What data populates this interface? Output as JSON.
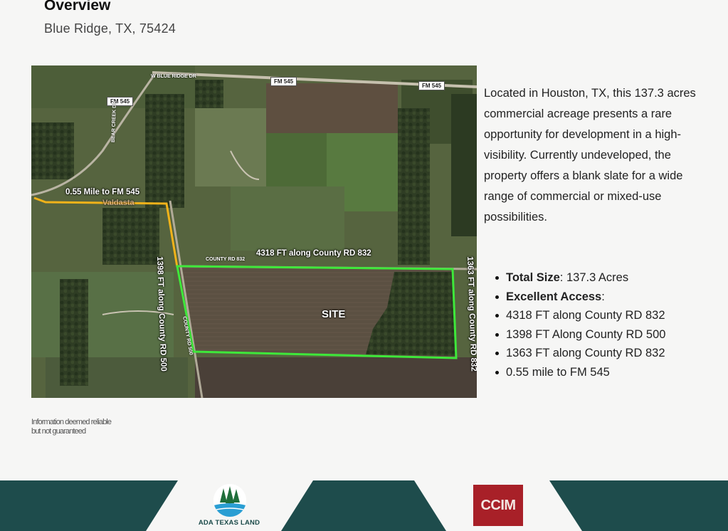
{
  "header": {
    "title": "Overview",
    "subtitle": "Blue Ridge, TX, 75424"
  },
  "map": {
    "labels": {
      "fm545_distance": "0.55 Mile to FM 545",
      "rd832_north": "4318 FT along County RD 832",
      "rd500": "1398 FT along County RD 500",
      "rd832_east": "1363 FT along County RD 832",
      "site": "SITE",
      "town": "Valdasta"
    },
    "roads": {
      "blue_ridge_dr": "W BLUE RIDGE DR",
      "fm545_a": "FM 545",
      "fm545_b": "FM 545",
      "fm545_c": "FM 545",
      "bear_creek_dr": "BEAR CREEK DR",
      "county_rd_832": "COUNTY RD 832",
      "county_rd_500": "COUNTY RD 500"
    },
    "colors": {
      "site_boundary": "#3ee83a",
      "access_route": "#f0b21a"
    }
  },
  "description": "Located in Houston, TX, this 137.3 acres commercial acreage presents a rare opportunity for development in a high-visibility. Currently undeveloped, the property offers a blank slate for a wide range of commercial or mixed-use possibilities.",
  "features": [
    {
      "label": "Total Size",
      "value": ": 137.3 Acres"
    },
    {
      "label": "Excellent Access",
      "value": ":"
    },
    {
      "label": "",
      "value": "4318 FT along County RD 832"
    },
    {
      "label": "",
      "value": "1398 FT Along County RD 500"
    },
    {
      "label": "",
      "value": "1363 FT along County RD 832"
    },
    {
      "label": "",
      "value": "0.55 mile to FM 545"
    }
  ],
  "disclaimer": {
    "line1": "Information deemed reliable",
    "line2": "but not guaranteed"
  },
  "footer": {
    "logo_left": "ADA TEXAS LAND",
    "logo_right": "CCIM",
    "colors": {
      "band": "#1e4c4c",
      "ccim": "#a82028"
    }
  }
}
